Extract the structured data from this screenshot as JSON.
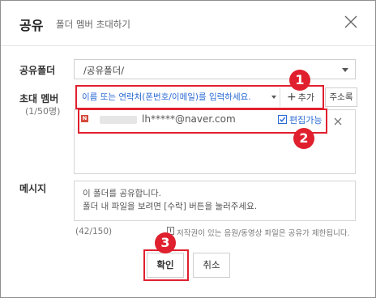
{
  "dialog": {
    "title": "공유",
    "subtitle": "폴더 멤버 초대하기"
  },
  "folder": {
    "label": "공유폴더",
    "value": "/공유폴더/"
  },
  "invite": {
    "label": "초대 멤버",
    "count": "(1/50명)",
    "placeholder": "이름 또는 연락처(폰번호/이메일)를 입력하세요.",
    "add_label": "추가",
    "address_label": "주소록"
  },
  "members": [
    {
      "service_badge": "N",
      "email": "lh*****@naver.com",
      "edit_label": "편집가능",
      "edit_checked": true
    }
  ],
  "message": {
    "label": "메시지",
    "line1": "이 폴더를 공유합니다.",
    "line2": "폴더 내 파일을 보려면 [수락] 버튼을 눌러주세요.",
    "count": "(42/150)",
    "notice": "저작권이 있는 음원/동영상 파일은 공유가 제한됩니다."
  },
  "buttons": {
    "confirm": "확인",
    "cancel": "취소"
  },
  "annotations": [
    "1",
    "2",
    "3"
  ],
  "colors": {
    "annotation": "#e0202e",
    "link": "#2a6ad3",
    "naver_badge": "#d54b3d"
  }
}
